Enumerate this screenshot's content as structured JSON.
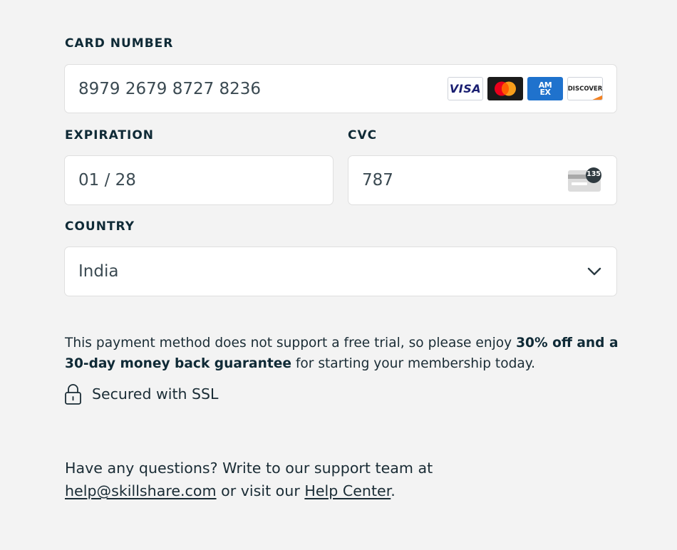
{
  "card": {
    "label": "CARD NUMBER",
    "value": "8979 2679 8727 8236",
    "brands": {
      "visa": "VISA",
      "mastercard": "",
      "amex_line1": "AM",
      "amex_line2": "EX",
      "discover": "DISCOVER"
    }
  },
  "expiration": {
    "label": "EXPIRATION",
    "value": "01 / 28"
  },
  "cvc": {
    "label": "CVC",
    "value": "787",
    "icon_badge": "135"
  },
  "country": {
    "label": "COUNTRY",
    "value": "India"
  },
  "note": {
    "text_before": "This payment method does not support a free trial, so please enjoy ",
    "bold": "30% off and a 30-day money back guarantee",
    "text_after": " for starting your membership today."
  },
  "ssl": {
    "label": "Secured with SSL"
  },
  "help": {
    "text_before": "Have any questions? Write to our support team at ",
    "email_link": "help@skillshare.com",
    "text_middle": " or visit our ",
    "center_link": "Help Center",
    "text_after": "."
  },
  "colors": {
    "background": "#f3f3f3",
    "text": "#0f2a36",
    "field_border": "#dfdfdf"
  }
}
